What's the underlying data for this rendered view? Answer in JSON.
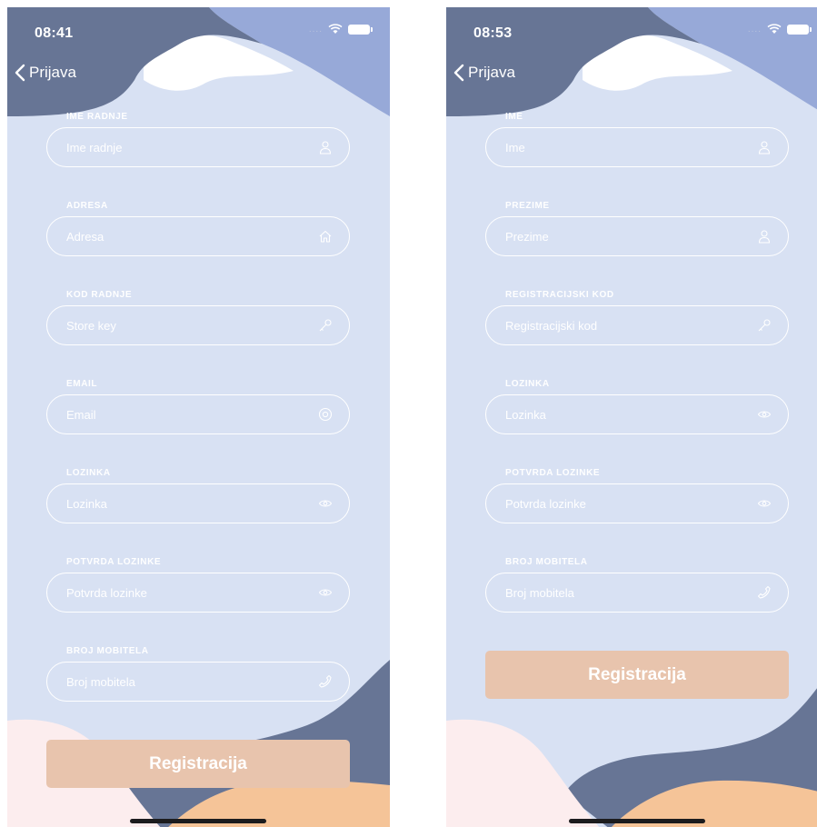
{
  "screens": [
    {
      "status_time": "08:41",
      "back_label": "Prijava",
      "fields": [
        {
          "label": "IME RADNJE",
          "placeholder": "Ime radnje",
          "icon": "person-icon"
        },
        {
          "label": "ADRESA",
          "placeholder": "Adresa",
          "icon": "home-icon"
        },
        {
          "label": "KOD RADNJE",
          "placeholder": "Store key",
          "icon": "key-icon"
        },
        {
          "label": "EMAIL",
          "placeholder": "Email",
          "icon": "at-icon"
        },
        {
          "label": "LOZINKA",
          "placeholder": "Lozinka",
          "icon": "eye-icon"
        },
        {
          "label": "POTVRDA LOZINKE",
          "placeholder": "Potvrda lozinke",
          "icon": "eye-icon"
        },
        {
          "label": "BROJ MOBITELA",
          "placeholder": "Broj mobitela",
          "icon": "phone-icon"
        }
      ],
      "submit_label": "Registracija"
    },
    {
      "status_time": "08:53",
      "back_label": "Prijava",
      "fields": [
        {
          "label": "IME",
          "placeholder": "Ime",
          "icon": "person-icon"
        },
        {
          "label": "PREZIME",
          "placeholder": "Prezime",
          "icon": "person-icon"
        },
        {
          "label": "REGISTRACIJSKI KOD",
          "placeholder": "Registracijski kod",
          "icon": "key-icon"
        },
        {
          "label": "LOZINKA",
          "placeholder": "Lozinka",
          "icon": "eye-icon"
        },
        {
          "label": "POTVRDA LOZINKE",
          "placeholder": "Potvrda lozinke",
          "icon": "eye-icon"
        },
        {
          "label": "BROJ MOBITELA",
          "placeholder": "Broj mobitela",
          "icon": "phone-icon"
        }
      ],
      "submit_label": "Registracija"
    }
  ],
  "colors": {
    "background": "#d8e1f3",
    "dark_blob": "#677595",
    "light_blob": "#97a9d8",
    "peach_blob": "#f5c498",
    "pink_blob": "#fcedee",
    "button": "#e8c4ad",
    "field_border": "#ffffff"
  }
}
